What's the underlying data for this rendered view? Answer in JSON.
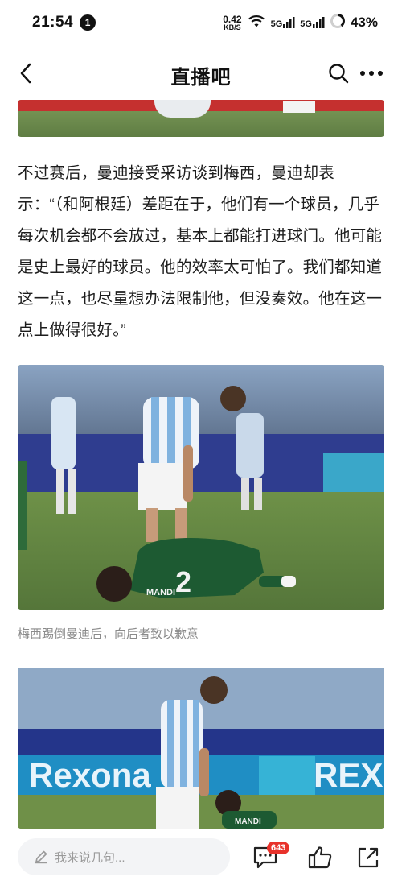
{
  "status_bar": {
    "time": "21:54",
    "notification_count": "1",
    "net_speed_value": "0.42",
    "net_speed_unit": "KB/S",
    "signal1_label": "5G",
    "signal2_label": "5G",
    "battery_percent": "43%"
  },
  "nav": {
    "title": "直播吧",
    "back_icon": "chevron-left-icon",
    "search_icon": "search-icon",
    "more_icon": "more-icon"
  },
  "article": {
    "paragraph": "不过赛后，曼迪接受采访谈到梅西，曼迪却表示：“（和阿根廷）差距在于，他们有一个球员，几乎每次机会都不会放过，基本上都能打进球门。他可能是史上最好的球员。他的效率太可怕了。我们都知道这一点，也尽量想办法限制他，但没奏效。他在这一点上做得很好。”",
    "photo2_caption": "梅西踢倒曼迪后，向后者致以歉意",
    "photo2_jersey_number": "2",
    "photo2_jersey_name": "MANDI",
    "photo3_board_text": "Rexona",
    "photo3_board_text2": "REX",
    "photo3_jersey_name": "MANDI"
  },
  "bottom_bar": {
    "comment_placeholder": "我来说几句...",
    "comment_count": "643",
    "comment_icon": "comment-icon",
    "like_icon": "thumbs-up-icon",
    "share_icon": "share-icon"
  }
}
